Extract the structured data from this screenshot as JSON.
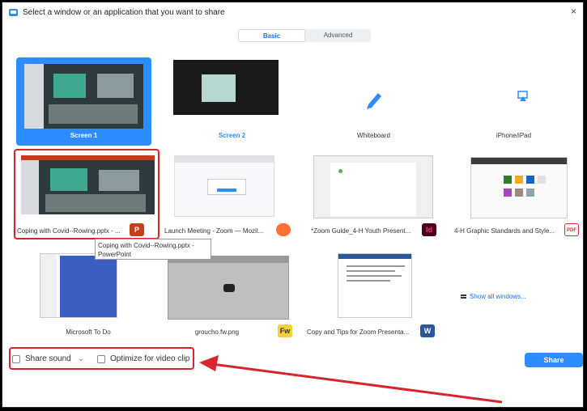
{
  "window": {
    "title": "Select a window or an application that you want to share",
    "close_glyph": "×"
  },
  "tabs": [
    {
      "label": "Basic",
      "active": true
    },
    {
      "label": "Advanced",
      "active": false
    }
  ],
  "tiles": [
    {
      "label": "Screen 1",
      "selected": true,
      "icon": "monitor-icon"
    },
    {
      "label": "Screen 2",
      "selected": false,
      "icon": "monitor-icon"
    },
    {
      "label": "Whiteboard",
      "icon": "pen-icon"
    },
    {
      "label": "iPhone/iPad",
      "icon": "airplay-icon"
    },
    {
      "label": "Coping with Covid--Rowing.pptx - ...",
      "app_icon": "powerpoint-icon",
      "app_badge": "P"
    },
    {
      "label": "Launch Meeting - Zoom — Mozil...",
      "app_icon": "firefox-icon"
    },
    {
      "label": "*Zoom Guide_4-H Youth Present...",
      "app_icon": "indesign-icon",
      "app_badge": "Id"
    },
    {
      "label": "4-H Graphic Standards and Style...",
      "app_icon": "pdf-icon",
      "app_badge": "PDF"
    },
    {
      "label": "Microsoft To Do",
      "app_icon": "todo-icon"
    },
    {
      "label": "groucho.fw.png",
      "app_icon": "fireworks-icon",
      "app_badge": "Fw"
    },
    {
      "label": "Copy and Tips for Zoom Presenta...",
      "app_icon": "word-icon",
      "app_badge": "W"
    }
  ],
  "show_all": {
    "label": "Show all windows...",
    "icon": "stack-icon"
  },
  "tooltip": {
    "line1": "Coping with Covid--Rowing.pptx -",
    "line2": "PowerPoint"
  },
  "options": {
    "share_sound": "Share sound",
    "optimize": "Optimize for video clip",
    "dropdown_glyph": "⌄"
  },
  "share_button": {
    "label": "Share"
  },
  "colors": {
    "accent": "#2d8cff",
    "annotation": "#d6262b"
  }
}
